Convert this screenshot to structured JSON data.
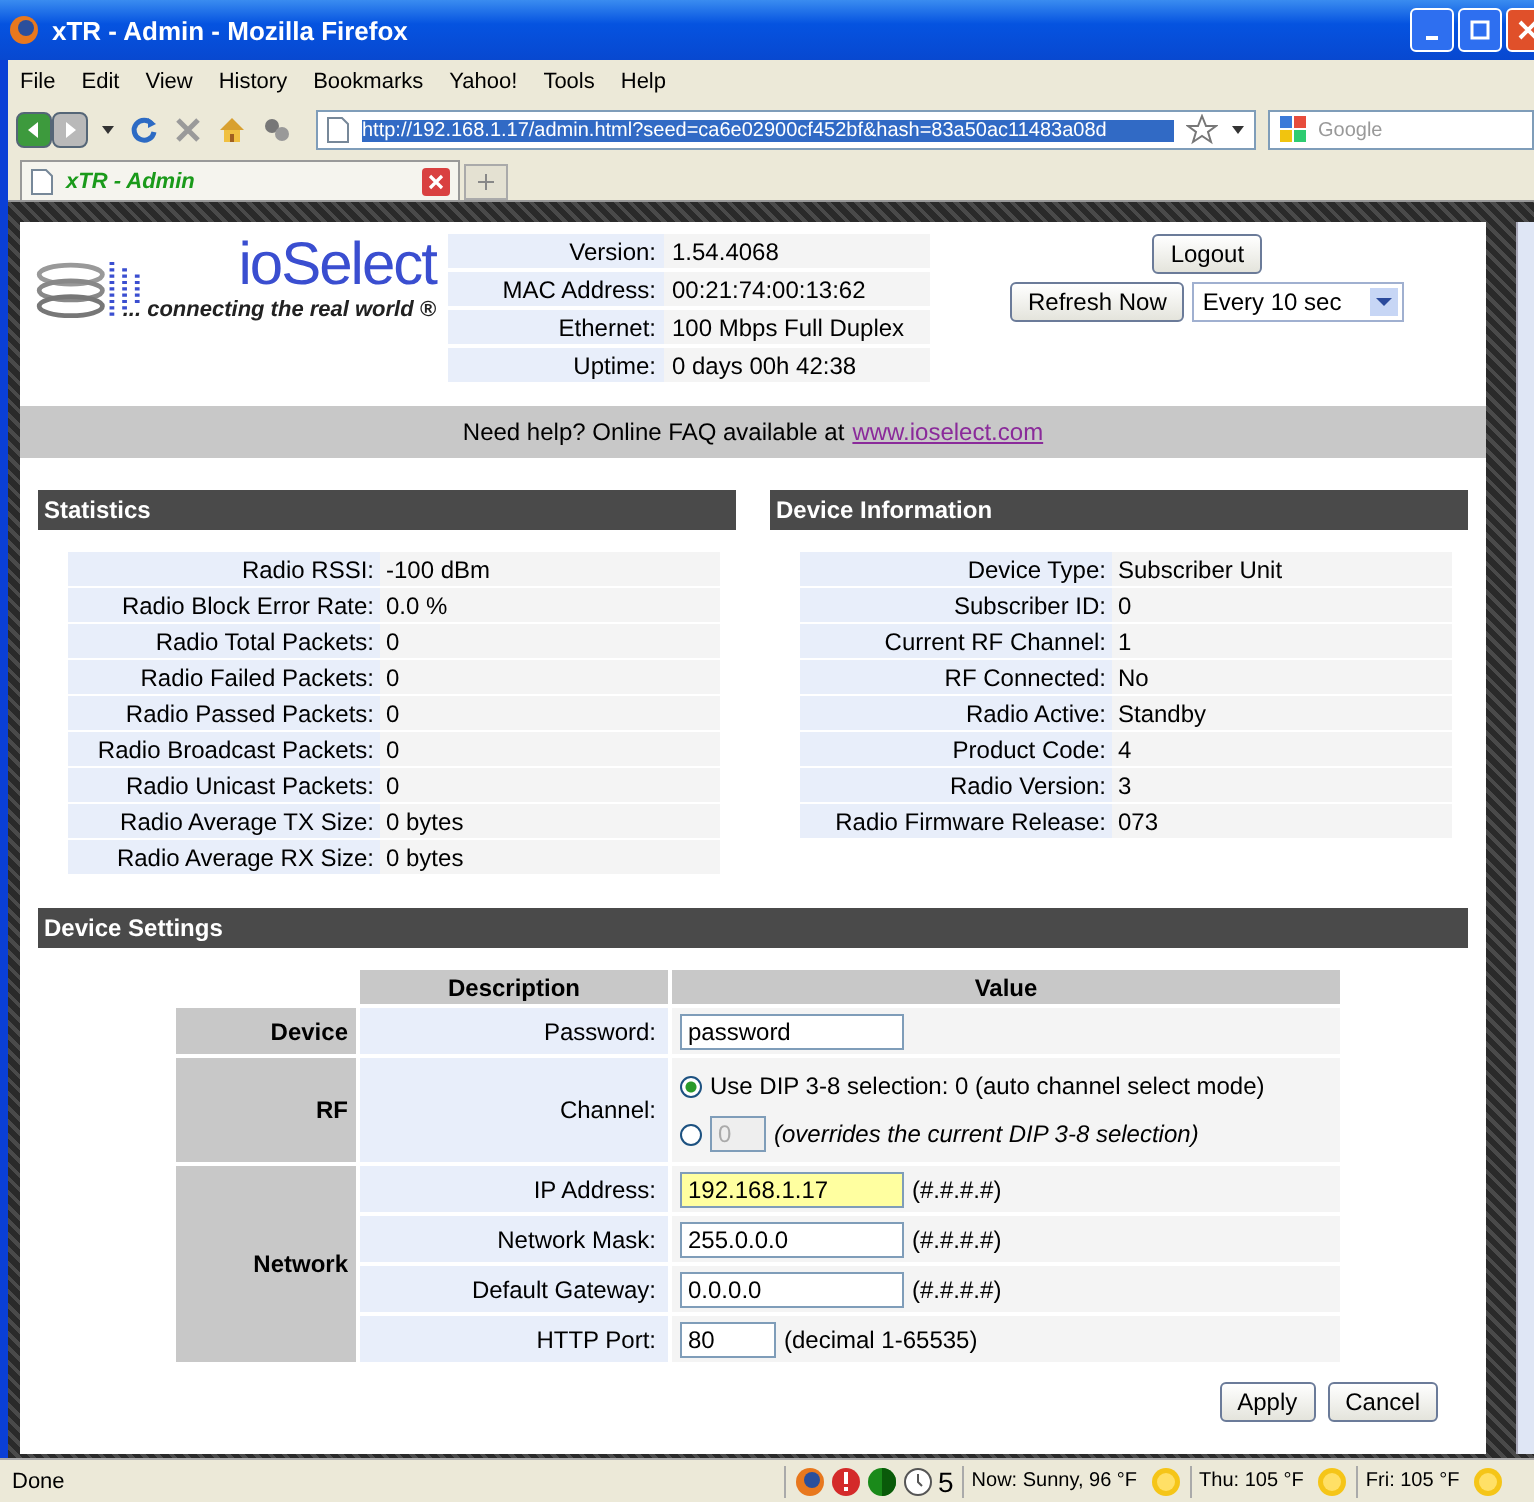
{
  "window": {
    "title": "xTR - Admin - Mozilla Firefox"
  },
  "menu": [
    "File",
    "Edit",
    "View",
    "History",
    "Bookmarks",
    "Yahoo!",
    "Tools",
    "Help"
  ],
  "address": {
    "value": "http://192.168.1.17/admin.html?seed=ca6e02900cf452bf&hash=83a50ac11483a08d"
  },
  "search": {
    "placeholder": "Google"
  },
  "tabs": [
    {
      "label": "xTR - Admin",
      "selected": true
    }
  ],
  "logo": {
    "name": "ioSelect",
    "tagline": "... connecting the real world ®"
  },
  "info": [
    {
      "label": "Version:",
      "value": "1.54.4068"
    },
    {
      "label": "MAC Address:",
      "value": "00:21:74:00:13:62"
    },
    {
      "label": "Ethernet:",
      "value": "100 Mbps Full Duplex"
    },
    {
      "label": "Uptime:",
      "value": "0 days 00h 42:38"
    }
  ],
  "logout": "Logout",
  "refresh": "Refresh Now",
  "interval": "Every 10 sec",
  "help": {
    "text": "Need help?   Online FAQ available at",
    "link": "www.ioselect.com"
  },
  "statistics": {
    "heading": "Statistics",
    "rows": [
      {
        "label": "Radio RSSI:",
        "value": "-100 dBm"
      },
      {
        "label": "Radio Block Error Rate:",
        "value": "0.0 %"
      },
      {
        "label": "Radio Total Packets:",
        "value": "0"
      },
      {
        "label": "Radio Failed Packets:",
        "value": "0"
      },
      {
        "label": "Radio Passed Packets:",
        "value": "0"
      },
      {
        "label": "Radio Broadcast Packets:",
        "value": "0"
      },
      {
        "label": "Radio Unicast Packets:",
        "value": "0"
      },
      {
        "label": "Radio Average TX Size:",
        "value": "0 bytes"
      },
      {
        "label": "Radio Average RX Size:",
        "value": "0 bytes"
      }
    ]
  },
  "device_info": {
    "heading": "Device Information",
    "rows": [
      {
        "label": "Device Type:",
        "value": "Subscriber Unit"
      },
      {
        "label": "Subscriber ID:",
        "value": "0"
      },
      {
        "label": "Current RF Channel:",
        "value": "1"
      },
      {
        "label": "RF Connected:",
        "value": "No"
      },
      {
        "label": "Radio Active:",
        "value": "Standby"
      },
      {
        "label": "Product Code:",
        "value": "4"
      },
      {
        "label": "Radio Version:",
        "value": "3"
      },
      {
        "label": "Radio Firmware Release:",
        "value": "073"
      }
    ]
  },
  "settings": {
    "heading": "Device Settings",
    "columns": [
      "Description",
      "Value"
    ],
    "groups": [
      {
        "name": "Device",
        "rows": [
          {
            "label": "Password:",
            "kind": "input",
            "value": "password",
            "highlighted": false
          }
        ]
      },
      {
        "name": "RF",
        "rows": [
          {
            "label": "Channel:",
            "kind": "radio",
            "options": [
              {
                "label": "Use DIP 3-8 selection: 0 (auto channel select mode)",
                "selected": true
              },
              {
                "value": "0",
                "hint": "(overrides the current DIP 3-8 selection)",
                "selected": false
              }
            ]
          }
        ]
      },
      {
        "name": "Network",
        "rows": [
          {
            "label": "IP Address:",
            "kind": "input",
            "value": "192.168.1.17",
            "hint": "(#.#.#.#)",
            "highlighted": true
          },
          {
            "label": "Network Mask:",
            "kind": "input",
            "value": "255.0.0.0",
            "hint": "(#.#.#.#)",
            "highlighted": false
          },
          {
            "label": "Default Gateway:",
            "kind": "input",
            "value": "0.0.0.0",
            "hint": "(#.#.#.#)",
            "highlighted": false
          },
          {
            "label": "HTTP Port:",
            "kind": "short",
            "value": "80",
            "hint": "(decimal 1-65535)",
            "highlighted": false
          }
        ]
      }
    ]
  },
  "actions": [
    "Apply",
    "Cancel"
  ],
  "status_bar": {
    "text": "Done",
    "count": "5",
    "weather": [
      "Now: Sunny, 96 °F",
      "Thu: 105 °F",
      "Fri: 105 °F"
    ]
  }
}
